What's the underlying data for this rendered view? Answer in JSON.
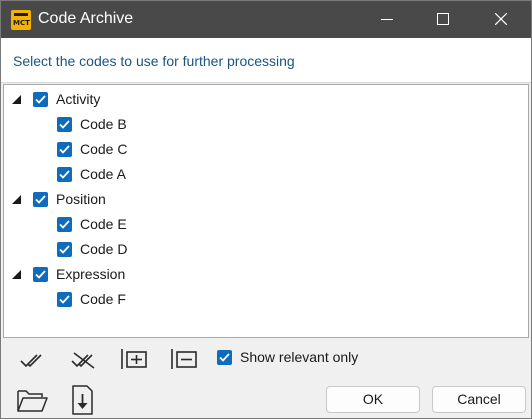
{
  "window": {
    "title": "Code Archive",
    "app_icon": "code-archive-app-icon",
    "app_icon_text": "MCT",
    "controls": [
      "minimize",
      "maximize",
      "close"
    ]
  },
  "instruction": "Select the codes to use for further processing",
  "tree": [
    {
      "label": "Activity",
      "checked": true,
      "expanded": true,
      "children": [
        {
          "label": "Code B",
          "checked": true
        },
        {
          "label": "Code C",
          "checked": true
        },
        {
          "label": "Code A",
          "checked": true
        }
      ]
    },
    {
      "label": "Position",
      "checked": true,
      "expanded": true,
      "children": [
        {
          "label": "Code E",
          "checked": true
        },
        {
          "label": "Code D",
          "checked": true
        }
      ]
    },
    {
      "label": "Expression",
      "checked": true,
      "expanded": true,
      "children": [
        {
          "label": "Code F",
          "checked": true
        }
      ]
    }
  ],
  "toolbar": {
    "icons": [
      "check-all-icon",
      "uncheck-all-icon",
      "expand-all-icon",
      "collapse-all-icon"
    ],
    "show_relevant_label": "Show relevant only",
    "show_relevant_checked": true
  },
  "footer": {
    "icons": [
      "open-folder-icon",
      "import-file-icon"
    ],
    "ok_label": "OK",
    "cancel_label": "Cancel"
  },
  "colors": {
    "titlebar": "#494949",
    "accent": "#0f6cbd",
    "instruction_text": "#1b5480"
  }
}
